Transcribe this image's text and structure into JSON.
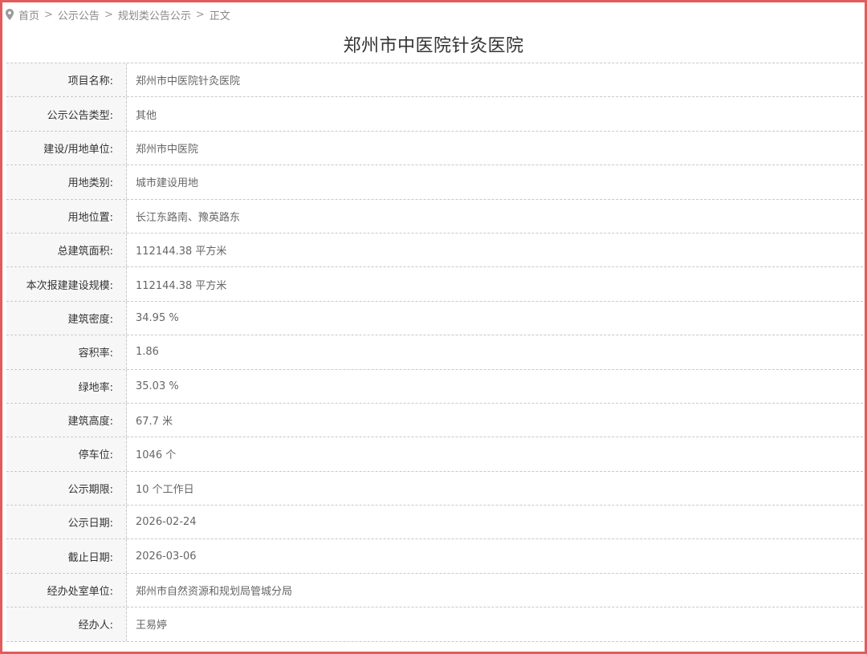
{
  "breadcrumb": {
    "icon": "location-pin-icon",
    "items": [
      "首页",
      "公示公告",
      "规划类公告公示",
      "正文"
    ],
    "separator": ">"
  },
  "title": "郑州市中医院针灸医院",
  "rows": [
    {
      "label": "项目名称:",
      "value": "郑州市中医院针灸医院"
    },
    {
      "label": "公示公告类型:",
      "value": "其他"
    },
    {
      "label": "建设/用地单位:",
      "value": "郑州市中医院"
    },
    {
      "label": "用地类别:",
      "value": "城市建设用地"
    },
    {
      "label": "用地位置:",
      "value": "长江东路南、豫英路东"
    },
    {
      "label": "总建筑面积:",
      "value": "112144.38 平方米"
    },
    {
      "label": "本次报建建设规模:",
      "value": "112144.38 平方米"
    },
    {
      "label": "建筑密度:",
      "value": "34.95 %"
    },
    {
      "label": "容积率:",
      "value": "1.86"
    },
    {
      "label": "绿地率:",
      "value": "35.03 %"
    },
    {
      "label": "建筑高度:",
      "value": "67.7 米"
    },
    {
      "label": "停车位:",
      "value": "1046 个"
    },
    {
      "label": "公示期限:",
      "value": "10 个工作日"
    },
    {
      "label": "公示日期:",
      "value": "2026-02-24"
    },
    {
      "label": "截止日期:",
      "value": "2026-03-06"
    },
    {
      "label": "经办处室单位:",
      "value": "郑州市自然资源和规划局管城分局"
    },
    {
      "label": "经办人:",
      "value": "王易婷"
    }
  ],
  "colors": {
    "frame_border": "#e35b5b",
    "label_bg": "#f7f7f7",
    "divider": "#c8c8c8"
  }
}
